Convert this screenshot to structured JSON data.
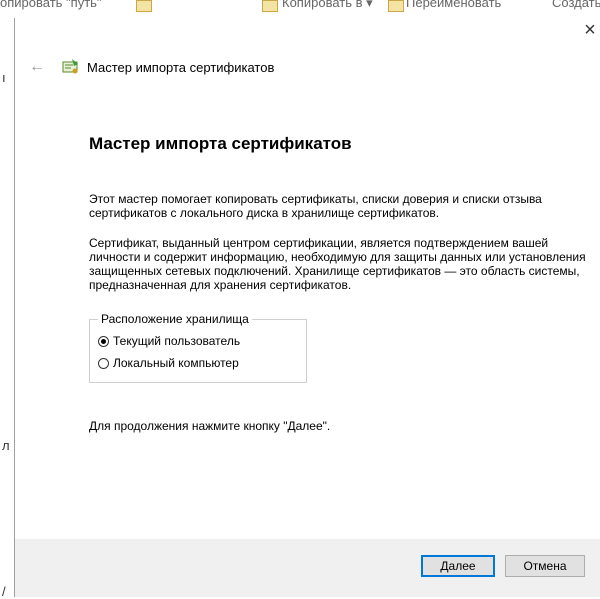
{
  "background": {
    "toolbar_text_1": "опировать \"путь\"",
    "toolbar_text_2": "Копировать в ▾",
    "toolbar_text_3": "Переименовать",
    "toolbar_text_4": "Создать",
    "left_chars": [
      "ı",
      "л",
      "/"
    ]
  },
  "dialog": {
    "close_glyph": "×",
    "back_glyph": "←",
    "header_title": "Мастер импорта сертификатов",
    "main_title": "Мастер импорта сертификатов",
    "paragraph_1": "Этот мастер помогает копировать сертификаты, списки доверия и списки отзыва сертификатов с локального диска в хранилище сертификатов.",
    "paragraph_2": "Сертификат, выданный центром сертификации, является подтверждением вашей личности и содержит информацию, необходимую для защиты данных или установления защищенных сетевых подключений. Хранилище сертификатов — это область системы, предназначенная для хранения сертификатов.",
    "store_location": {
      "legend": "Расположение хранилища",
      "options": [
        {
          "label": "Текущий пользователь",
          "selected": true
        },
        {
          "label": "Локальный компьютер",
          "selected": false
        }
      ]
    },
    "continue_text": "Для продолжения нажмите кнопку \"Далее\".",
    "buttons": {
      "next": "Далее",
      "cancel": "Отмена"
    }
  },
  "colors": {
    "accent": "#0078d7",
    "footer_bg": "#f0f0f0"
  },
  "icons": {
    "wizard": "certificate-icon",
    "back": "back-arrow-icon",
    "close": "close-icon"
  }
}
